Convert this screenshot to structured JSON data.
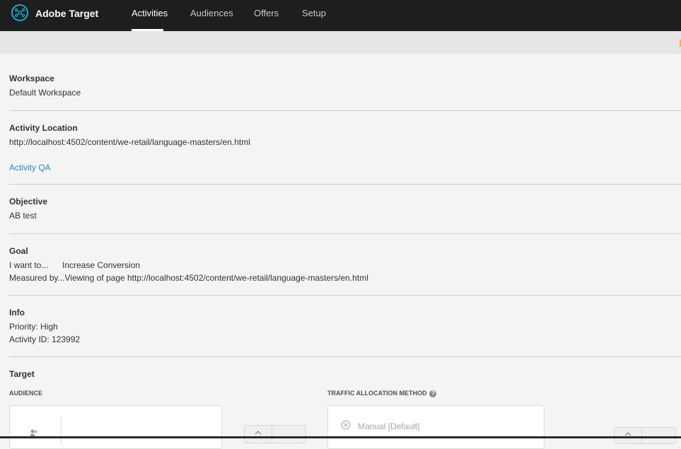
{
  "app": {
    "brand": "Adobe Target"
  },
  "nav": {
    "items": [
      {
        "label": "Activities",
        "active": true
      },
      {
        "label": "Audiences",
        "active": false
      },
      {
        "label": "Offers",
        "active": false
      },
      {
        "label": "Setup",
        "active": false
      }
    ]
  },
  "colors": {
    "accent": "#2b8ad0",
    "topbar": "#1e1e1e",
    "logo": "#1fa8d6"
  },
  "workspace": {
    "label": "Workspace",
    "value": "Default Workspace"
  },
  "activity_location": {
    "label": "Activity Location",
    "url": "http://localhost:4502/content/we-retail/language-masters/en.html",
    "qa_link": "Activity QA"
  },
  "objective": {
    "label": "Objective",
    "value": "AB test"
  },
  "goal": {
    "label": "Goal",
    "want_key": "I want to...",
    "want_value": "Increase Conversion",
    "measured_key": "Measured by...",
    "measured_value": "Viewing of page http://localhost:4502/content/we-retail/language-masters/en.html"
  },
  "info": {
    "label": "Info",
    "priority": "Priority: High",
    "activity_id": "Activity ID: 123992"
  },
  "target": {
    "label": "Target",
    "audience_heading": "AUDIENCE",
    "traffic_heading": "TRAFFIC ALLOCATION METHOD",
    "traffic_option": "Manual [Default]"
  }
}
